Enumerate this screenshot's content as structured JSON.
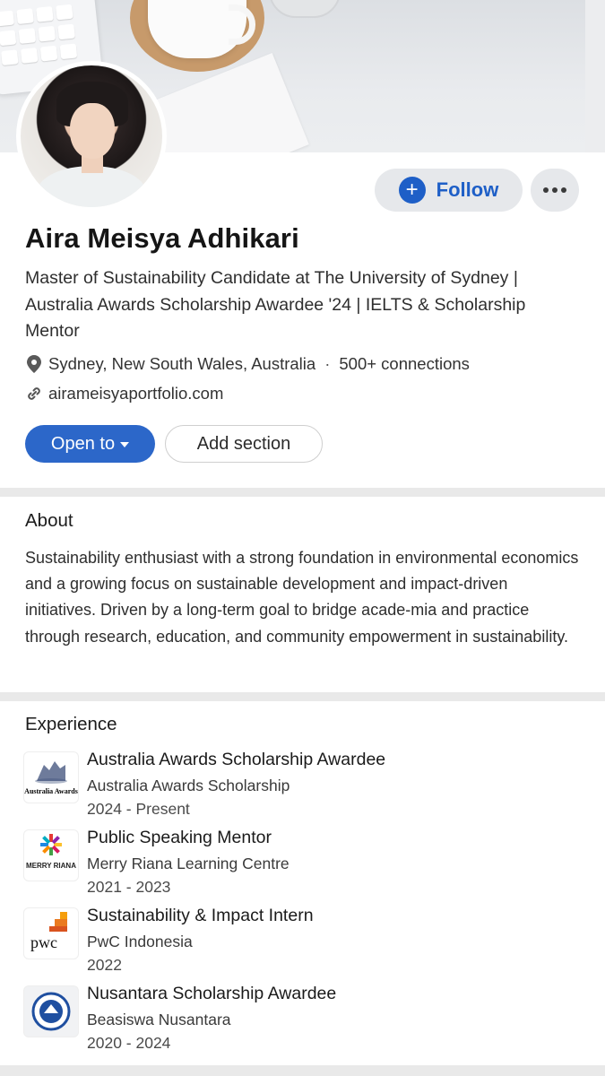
{
  "profile": {
    "name": "Aira Meisya Adhikari",
    "headline": "Master of Sustainability Candidate at The University of Sydney | Australia Awards Scholarship Awardee '24 | IELTS & Scholarship Mentor",
    "location": "Sydney, New South Wales, Australia",
    "separator": "·",
    "connections": "500+ connections",
    "website": "airameisyaportfolio.com"
  },
  "actions": {
    "follow_label": "Follow",
    "follow_icon": "plus-icon",
    "more_icon": "ellipsis-icon",
    "open_to_label": "Open to",
    "add_section_label": "Add section"
  },
  "about": {
    "title": "About",
    "text": "Sustainability enthusiast with a strong foundation in environmental economics and a growing focus on sustainable development and impact-driven initiatives. Driven by a long-term goal to bridge acade-mia and practice through research, education, and community empowerment in sustainability."
  },
  "experience": {
    "title": "Experience",
    "items": [
      {
        "title": "Australia Awards Scholarship Awardee",
        "company": "Australia Awards Scholarship",
        "dates": "2024 - Present",
        "logo_text": "Australia Awards"
      },
      {
        "title": "Public Speaking Mentor",
        "company": "Merry Riana Learning Centre",
        "dates": "2021 - 2023",
        "logo_text": "MERRY RIANA"
      },
      {
        "title": "Sustainability & Impact Intern",
        "company": "PwC Indonesia",
        "dates": "2022",
        "logo_text": "pwc"
      },
      {
        "title": "Nusantara Scholarship Awardee",
        "company": "Beasiswa Nusantara",
        "dates": "2020 - 2024",
        "logo_text": ""
      }
    ]
  },
  "colors": {
    "accent": "#2c67c9",
    "follow_text": "#1e5fc7",
    "button_bg": "#e6e8eb"
  }
}
